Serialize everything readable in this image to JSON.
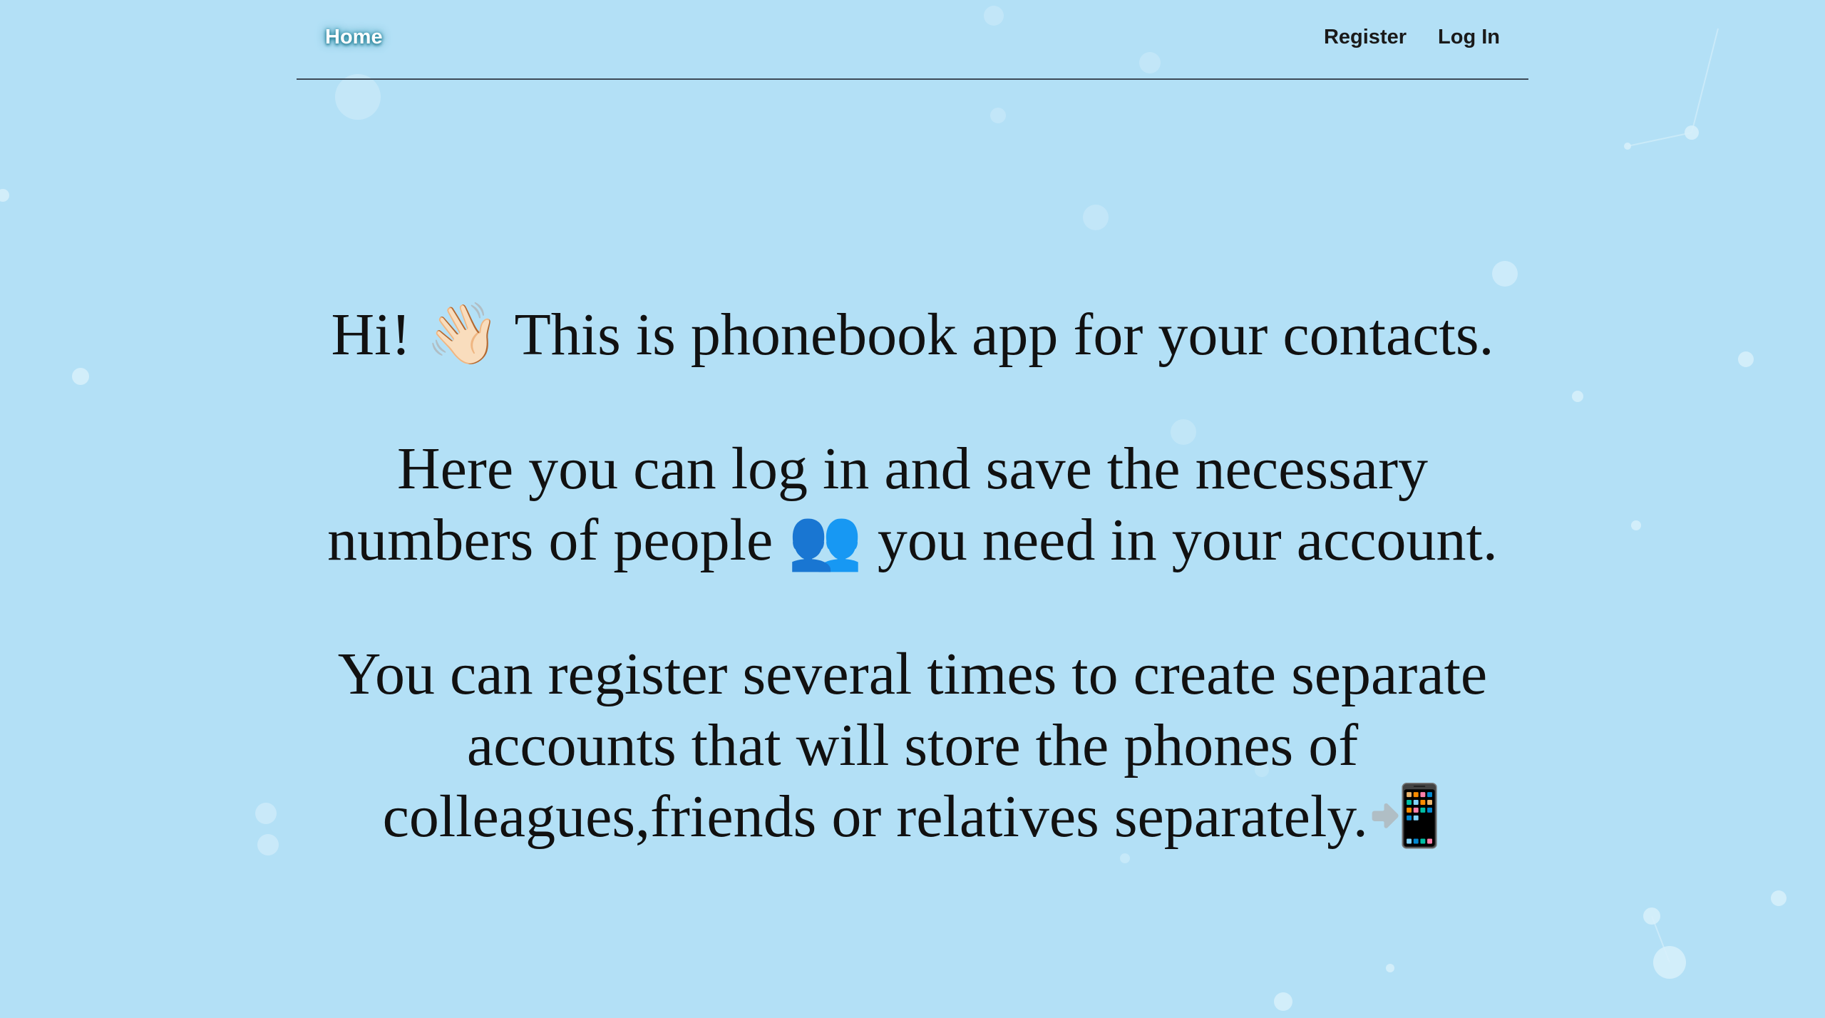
{
  "nav": {
    "home_label": "Home",
    "register_label": "Register",
    "login_label": "Log In"
  },
  "main": {
    "greeting": "Hi! 👋🏻 This is phonebook app for your contacts.",
    "description": "Here you can log in and save the necessary numbers of people 👥 you need in your account.",
    "register_info": "You can register several times to create separate accounts that will store the phones of colleagues,friends or relatives separately.📲"
  },
  "colors": {
    "background": "#b3e0f6",
    "text": "#111111",
    "home_text": "#ffffff",
    "home_glow": "#2a8aa0",
    "divider": "#3d4a57"
  }
}
